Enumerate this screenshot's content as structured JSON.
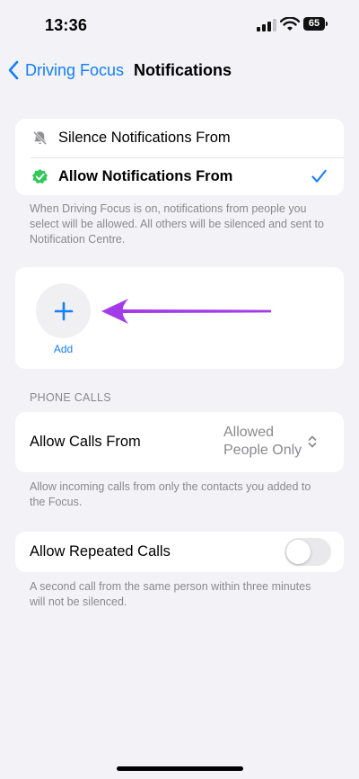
{
  "status_bar": {
    "time": "13:36",
    "battery": "65"
  },
  "nav": {
    "back_label": "Driving Focus",
    "title": "Notifications"
  },
  "notification_mode": {
    "options": [
      {
        "label": "Silence Notifications From",
        "icon": "bell-slash-icon",
        "selected": false
      },
      {
        "label": "Allow Notifications From",
        "icon": "checkmark-shield-icon",
        "selected": true
      }
    ],
    "footnote": "When Driving Focus is on, notifications from people you select will be allowed. All others will be silenced and sent to Notification Centre."
  },
  "people": {
    "add_label": "Add"
  },
  "phone_calls": {
    "header": "PHONE CALLS",
    "allow_calls_label": "Allow Calls From",
    "allow_calls_value_line1": "Allowed",
    "allow_calls_value_line2": "People Only",
    "allow_calls_footnote": "Allow incoming calls from only the contacts you added to the Focus.",
    "repeated_calls_label": "Allow Repeated Calls",
    "repeated_calls_enabled": false,
    "repeated_calls_footnote": "A second call from the same person within three minutes will not be silenced."
  },
  "colors": {
    "accent": "#147efb",
    "allow_icon": "#34c759",
    "annotation_arrow": "#a43be8"
  }
}
